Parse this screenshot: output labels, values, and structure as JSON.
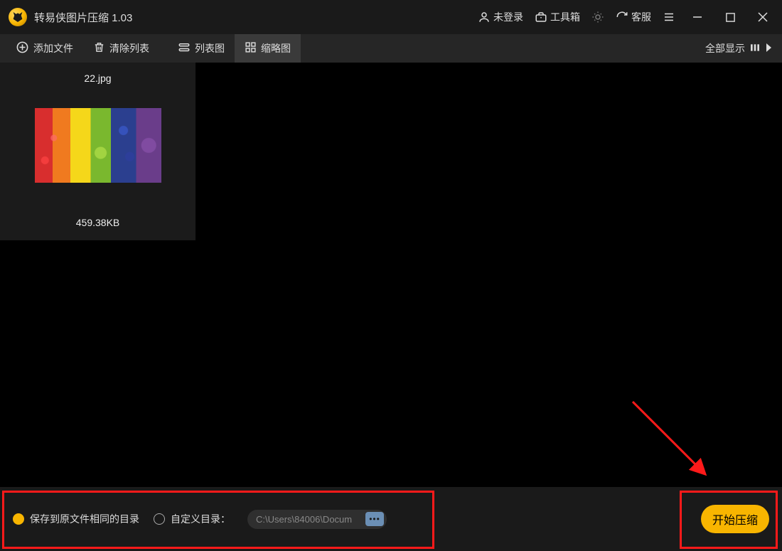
{
  "app": {
    "title": "转易侠图片压缩 1.03"
  },
  "titlebar": {
    "login": "未登录",
    "toolbox": "工具箱",
    "service": "客服"
  },
  "toolbar": {
    "add_file": "添加文件",
    "clear_list": "清除列表",
    "list_view": "列表图",
    "thumb_view": "缩略图",
    "show_all": "全部显示"
  },
  "file": {
    "name": "22.jpg",
    "size": "459.38KB"
  },
  "bottom": {
    "save_same_dir": "保存到原文件相同的目录",
    "custom_dir": "自定义目录：",
    "path": "C:\\Users\\84006\\Docum",
    "browse": "•••",
    "start": "开始压缩"
  }
}
